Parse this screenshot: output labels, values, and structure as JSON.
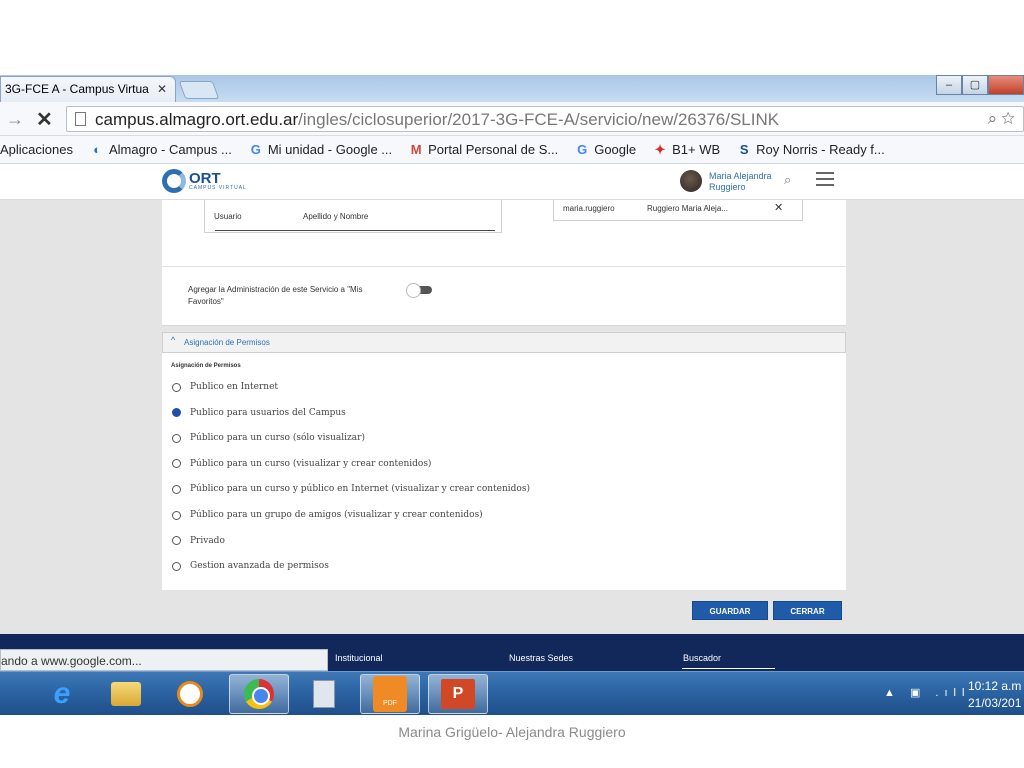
{
  "browser": {
    "tab_title": "3G-FCE A - Campus Virtua",
    "tab_close": "✕",
    "url_host": "campus.almagro.ort.edu.ar",
    "url_path": "/ingles/ciclosuperior/2017-3G-FCE-A/servicio/new/26376/SLINK",
    "bookmarks": [
      {
        "label": "Aplicaciones",
        "icon": "apps-icon"
      },
      {
        "label": "Almagro - Campus ...",
        "icon": "ort-icon"
      },
      {
        "label": "Mi unidad - Google ...",
        "icon": "google-drive-icon"
      },
      {
        "label": "Portal Personal de S...",
        "icon": "gmail-icon"
      },
      {
        "label": "Google",
        "icon": "google-icon"
      },
      {
        "label": "B1+ WB",
        "icon": "b1-icon"
      },
      {
        "label": "Roy Norris - Ready f...",
        "icon": "ready-icon"
      }
    ]
  },
  "site": {
    "logo_text": "ORT",
    "logo_sub": "CAMPUS VIRTUAL",
    "user_first": "Maria Alejandra",
    "user_last": "Ruggiero"
  },
  "members_table": {
    "col_user": "Usuario",
    "col_name": "Apellido y Nombre",
    "row_user": "maria.ruggiero",
    "row_name": "Ruggiero Maria Aleja...",
    "remove": "✕"
  },
  "favorites": {
    "label": "Agregar la Administración de este Servicio a \"Mis Favoritos\"",
    "enabled": false
  },
  "permissions": {
    "section_title": "Asignación de Permisos",
    "subtitle": "Asignación de Permisos",
    "options": [
      {
        "label": "Publico en Internet",
        "selected": false
      },
      {
        "label": "Publico para usuarios del Campus",
        "selected": true
      },
      {
        "label": "Público para un curso (sólo visualizar)",
        "selected": false
      },
      {
        "label": "Público para un curso (visualizar y crear contenidos)",
        "selected": false
      },
      {
        "label": "Público para un curso y público en Internet (visualizar y crear contenidos)",
        "selected": false
      },
      {
        "label": "Público para un grupo de amigos (visualizar y crear contenidos)",
        "selected": false
      },
      {
        "label": "Privado",
        "selected": false
      },
      {
        "label": "Gestion avanzada de permisos",
        "selected": false
      }
    ]
  },
  "actions": {
    "save": "GUARDAR",
    "close": "CERRAR"
  },
  "footer": {
    "status_text": "ando a www.google.com...",
    "links": [
      "Institucional",
      "Nuestras Sedes",
      "Buscador"
    ]
  },
  "taskbar": {
    "time": "10:12 a.m",
    "date": "21/03/201"
  },
  "caption": "Marina Grigüelo- Alejandra Ruggiero",
  "colors": {
    "accent": "#1f5ba9",
    "footer": "#13285a",
    "link": "#2d6fb1"
  }
}
